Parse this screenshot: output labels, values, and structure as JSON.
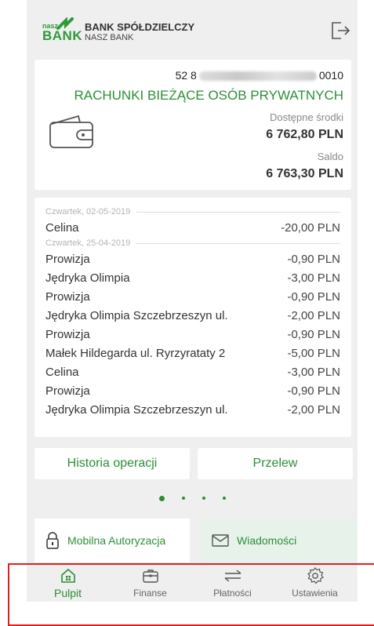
{
  "header": {
    "logo_small": "nasz",
    "logo_big": "BANK",
    "bank_name": "BANK SPÓŁDZIELCZY",
    "bank_sub": "NASZ BANK",
    "logout_icon": "logout-icon"
  },
  "account": {
    "number_prefix": "52 8",
    "number_suffix": "0010",
    "type": "RACHUNKI BIEŻĄCE OSÓB PRYWATNYCH",
    "available_label": "Dostępne środki",
    "available_value": "6 762,80 PLN",
    "saldo_label": "Saldo",
    "saldo_value": "6 763,30 PLN"
  },
  "transactions": [
    {
      "date": "Czwartek, 02-05-2019"
    },
    {
      "name": "Celina",
      "amount": "-20,00 PLN"
    },
    {
      "date": "Czwartek, 25-04-2019"
    },
    {
      "name": "Prowizja",
      "amount": "-0,90 PLN"
    },
    {
      "name": "Jędryka Olimpia",
      "amount": "-3,00 PLN"
    },
    {
      "name": "Prowizja",
      "amount": "-0,90 PLN"
    },
    {
      "name": "Jędryka Olimpia  Szczebrzeszyn ul.",
      "amount": "-2,00 PLN"
    },
    {
      "name": "Prowizja",
      "amount": "-0,90 PLN"
    },
    {
      "name": "Małek Hildegarda  ul. Ryrzyrataty 2",
      "amount": "-5,00 PLN"
    },
    {
      "name": "Celina",
      "amount": "-3,00 PLN"
    },
    {
      "name": "Prowizja",
      "amount": "-0,90 PLN"
    },
    {
      "name": "Jędryka Olimpia  Szczebrzeszyn ul.",
      "amount": "-2,00 PLN"
    }
  ],
  "buttons": {
    "history": "Historia operacji",
    "transfer": "Przelew"
  },
  "pager": {
    "count": 4,
    "active": 0
  },
  "tiles": {
    "auth": "Mobilna Autoryzacja",
    "messages": "Wiadomości"
  },
  "nav": [
    {
      "label": "Pulpit",
      "icon": "home-icon",
      "active": true
    },
    {
      "label": "Finanse",
      "icon": "briefcase-icon",
      "active": false
    },
    {
      "label": "Płatności",
      "icon": "transfer-arrows-icon",
      "active": false
    },
    {
      "label": "Ustawienia",
      "icon": "gear-icon",
      "active": false
    }
  ],
  "colors": {
    "accent": "#2c8f34",
    "background": "#efefef",
    "highlight": "#e0201f"
  }
}
